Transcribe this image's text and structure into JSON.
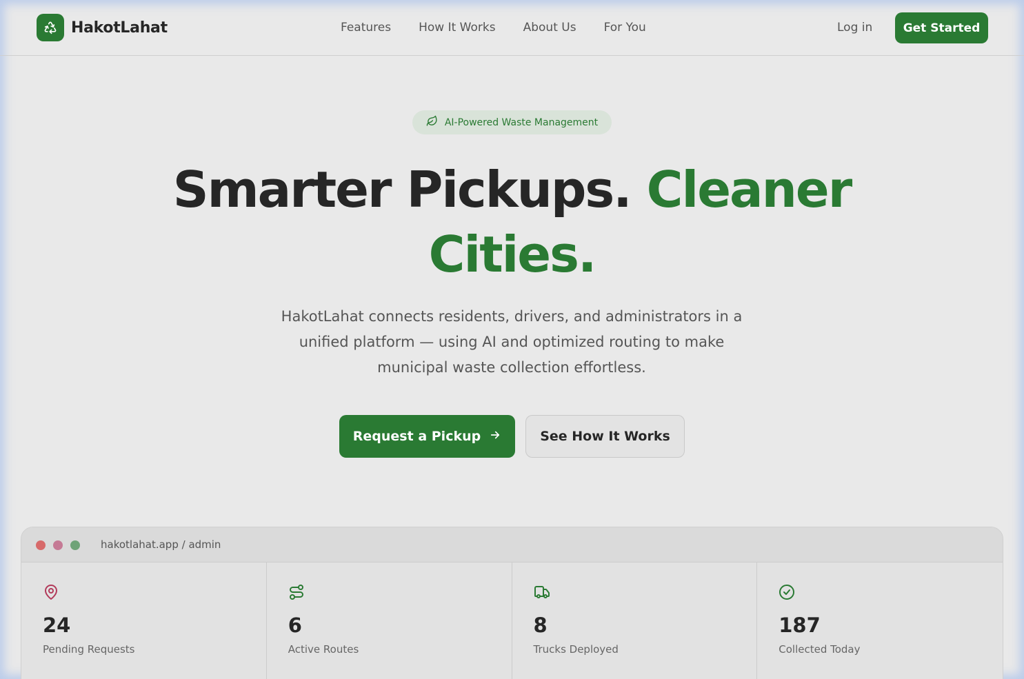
{
  "brand": {
    "name": "HakotLahat",
    "accent": "#2a7a33"
  },
  "nav": {
    "items": [
      "Features",
      "How It Works",
      "About Us",
      "For You"
    ],
    "login": "Log in",
    "cta": "Get Started"
  },
  "hero": {
    "badge": "AI-Powered Waste Management",
    "headline_dark": "Smarter Pickups.",
    "headline_accent_1": "Cleaner",
    "headline_accent_2": "Cities.",
    "lead": "HakotLahat connects residents, drivers, and administrators in a unified platform — using AI and optimized routing to make municipal waste collection effortless.",
    "primary_cta": "Request a Pickup",
    "secondary_cta": "See How It Works"
  },
  "preview": {
    "url": "hakotlahat.app / admin",
    "stats": [
      {
        "value": "24",
        "label": "Pending Requests",
        "icon": "map-pin-icon",
        "color": "#b23a5a"
      },
      {
        "value": "6",
        "label": "Active Routes",
        "icon": "route-icon",
        "color": "#2a7a33"
      },
      {
        "value": "8",
        "label": "Trucks Deployed",
        "icon": "truck-icon",
        "color": "#2a7a33"
      },
      {
        "value": "187",
        "label": "Collected Today",
        "icon": "check-circle-icon",
        "color": "#2a7a33"
      }
    ]
  }
}
